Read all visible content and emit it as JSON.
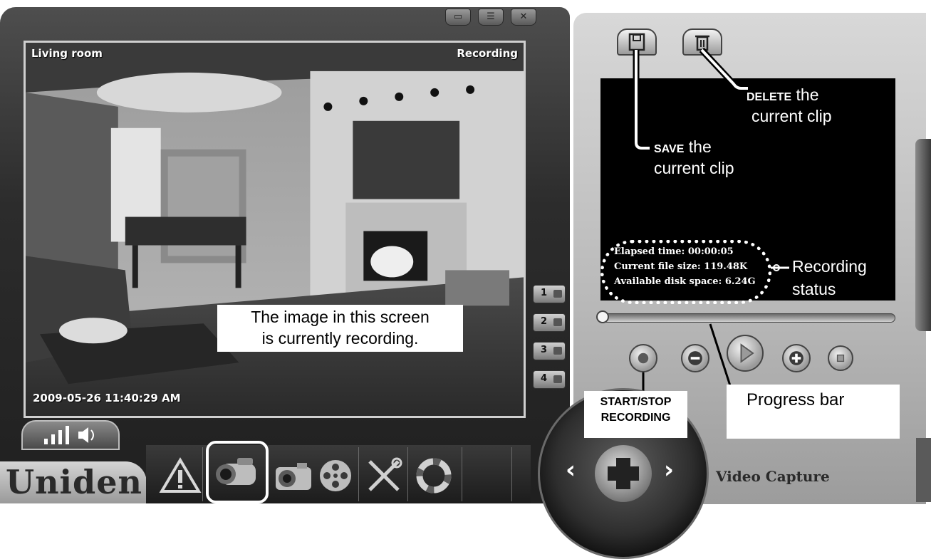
{
  "window": {
    "controls": [
      "minimize",
      "menu",
      "close"
    ]
  },
  "video": {
    "camera_name": "Living room",
    "recording_indicator": "Recording",
    "timestamp": "2009-05-26 11:40:29 AM",
    "callout_line1": "The image in this screen",
    "callout_line2": "is currently recording."
  },
  "camera_buttons": [
    {
      "label": "1"
    },
    {
      "label": "2"
    },
    {
      "label": "3"
    },
    {
      "label": "4"
    }
  ],
  "brand": {
    "name": "Uniden"
  },
  "toolbar": {
    "items": [
      {
        "icon": "alert-icon",
        "name": "alert"
      },
      {
        "icon": "video-camera-icon",
        "name": "video-capture",
        "selected": true
      },
      {
        "icon": "camera-icon",
        "name": "snapshot"
      },
      {
        "icon": "film-reel-icon",
        "name": "playback"
      },
      {
        "icon": "tools-icon",
        "name": "settings"
      },
      {
        "icon": "lifebuoy-icon",
        "name": "help"
      }
    ]
  },
  "recorder": {
    "save_label_bold": "SAVE",
    "save_label_rest": "the",
    "save_label_line2": "current clip",
    "delete_label_bold": "DELETE",
    "delete_label_rest": "the",
    "delete_label_line2": "current clip",
    "status": {
      "elapsed": "Elapsed time: 00:00:05",
      "file_size": "Current file size: 119.48K",
      "disk_space": "Available disk space: 6.24G",
      "label_line1": "Recording",
      "label_line2": "status"
    },
    "progress": 0,
    "progress_label": "Progress bar",
    "startstop_line1": "START/STOP",
    "startstop_line2": "RECORDING"
  },
  "panel_title": "Video Capture",
  "colors": {
    "frame": "#2c2c2c",
    "panel": "#c8c8c8",
    "screen": "#000000",
    "callout": "#ffffff"
  }
}
